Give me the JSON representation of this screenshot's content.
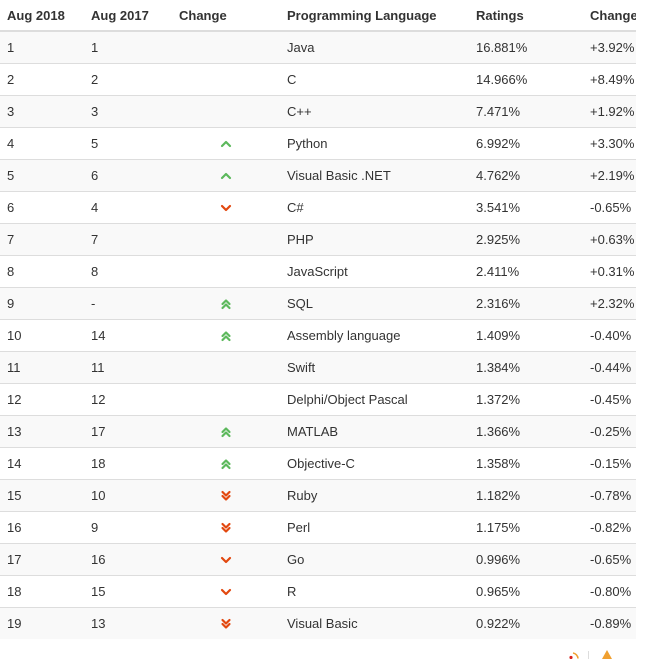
{
  "colors": {
    "up": "#5cb85c",
    "down": "#e2480f",
    "stripe": "#f9f9f9",
    "border": "#dddddd",
    "text": "#333333"
  },
  "table": {
    "headers": [
      "Aug 2018",
      "Aug 2017",
      "Change",
      "Programming Language",
      "Ratings",
      "Change"
    ],
    "rows": [
      {
        "rank_2018": "1",
        "rank_2017": "1",
        "change_icon": "none",
        "language": "Java",
        "rating": "16.881%",
        "change": "+3.92%"
      },
      {
        "rank_2018": "2",
        "rank_2017": "2",
        "change_icon": "none",
        "language": "C",
        "rating": "14.966%",
        "change": "+8.49%"
      },
      {
        "rank_2018": "3",
        "rank_2017": "3",
        "change_icon": "none",
        "language": "C++",
        "rating": "7.471%",
        "change": "+1.92%"
      },
      {
        "rank_2018": "4",
        "rank_2017": "5",
        "change_icon": "up",
        "language": "Python",
        "rating": "6.992%",
        "change": "+3.30%"
      },
      {
        "rank_2018": "5",
        "rank_2017": "6",
        "change_icon": "up",
        "language": "Visual Basic .NET",
        "rating": "4.762%",
        "change": "+2.19%"
      },
      {
        "rank_2018": "6",
        "rank_2017": "4",
        "change_icon": "down",
        "language": "C#",
        "rating": "3.541%",
        "change": "-0.65%"
      },
      {
        "rank_2018": "7",
        "rank_2017": "7",
        "change_icon": "none",
        "language": "PHP",
        "rating": "2.925%",
        "change": "+0.63%"
      },
      {
        "rank_2018": "8",
        "rank_2017": "8",
        "change_icon": "none",
        "language": "JavaScript",
        "rating": "2.411%",
        "change": "+0.31%"
      },
      {
        "rank_2018": "9",
        "rank_2017": "-",
        "change_icon": "double-up",
        "language": "SQL",
        "rating": "2.316%",
        "change": "+2.32%"
      },
      {
        "rank_2018": "10",
        "rank_2017": "14",
        "change_icon": "double-up",
        "language": "Assembly language",
        "rating": "1.409%",
        "change": "-0.40%"
      },
      {
        "rank_2018": "11",
        "rank_2017": "11",
        "change_icon": "none",
        "language": "Swift",
        "rating": "1.384%",
        "change": "-0.44%"
      },
      {
        "rank_2018": "12",
        "rank_2017": "12",
        "change_icon": "none",
        "language": "Delphi/Object Pascal",
        "rating": "1.372%",
        "change": "-0.45%"
      },
      {
        "rank_2018": "13",
        "rank_2017": "17",
        "change_icon": "double-up",
        "language": "MATLAB",
        "rating": "1.366%",
        "change": "-0.25%"
      },
      {
        "rank_2018": "14",
        "rank_2017": "18",
        "change_icon": "double-up",
        "language": "Objective-C",
        "rating": "1.358%",
        "change": "-0.15%"
      },
      {
        "rank_2018": "15",
        "rank_2017": "10",
        "change_icon": "double-down",
        "language": "Ruby",
        "rating": "1.182%",
        "change": "-0.78%"
      },
      {
        "rank_2018": "16",
        "rank_2017": "9",
        "change_icon": "double-down",
        "language": "Perl",
        "rating": "1.175%",
        "change": "-0.82%"
      },
      {
        "rank_2018": "17",
        "rank_2017": "16",
        "change_icon": "down",
        "language": "Go",
        "rating": "0.996%",
        "change": "-0.65%"
      },
      {
        "rank_2018": "18",
        "rank_2017": "15",
        "change_icon": "down",
        "language": "R",
        "rating": "0.965%",
        "change": "-0.80%"
      },
      {
        "rank_2018": "19",
        "rank_2017": "13",
        "change_icon": "double-down",
        "language": "Visual Basic",
        "rating": "0.922%",
        "change": "-0.89%"
      }
    ]
  },
  "corner_widget": {
    "icons": [
      "rss-icon",
      "back-to-top-icon"
    ]
  }
}
